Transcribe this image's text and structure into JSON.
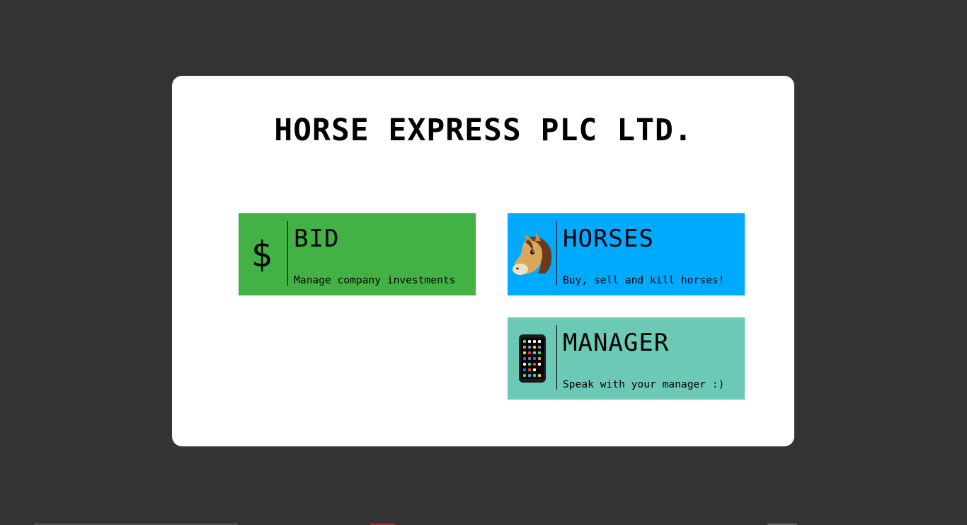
{
  "app": {
    "title": "HORSE EXPRESS PLC LTD."
  },
  "colors": {
    "background": "#333333",
    "modal": "#ffffff",
    "bid": "#43b244",
    "horses": "#00aaff",
    "manager": "#6bc9b5"
  },
  "tiles": [
    {
      "key": "bid",
      "icon": "dollar-icon",
      "symbol": "$",
      "title": "BID",
      "description": "Manage company investments"
    },
    {
      "key": "horses",
      "icon": "horse-face-icon",
      "title": "HORSES",
      "description": "Buy, sell and kill horses!"
    },
    {
      "key": "manager",
      "icon": "mobile-phone-icon",
      "title": "MANAGER",
      "description": "Speak with your manager :)"
    }
  ]
}
